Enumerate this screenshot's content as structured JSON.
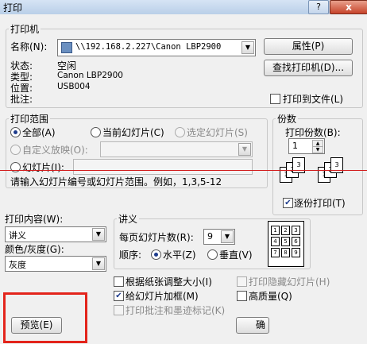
{
  "window": {
    "title": "打印",
    "help": "?",
    "close": "x"
  },
  "printer": {
    "group_label": "打印机",
    "name_label": "名称(N):",
    "name_value": "\\\\192.168.2.227\\Canon LBP2900",
    "status_label": "状态:",
    "status_value": "空闲",
    "type_label": "类型:",
    "type_value": "Canon LBP2900",
    "location_label": "位置:",
    "location_value": "USB004",
    "comment_label": "批注:",
    "properties_button": "属性(P)",
    "find_printer_button": "查找打印机(D)...",
    "print_to_file": "打印到文件(L)"
  },
  "range": {
    "group_label": "打印范围",
    "all": "全部(A)",
    "current": "当前幻灯片(C)",
    "selection": "选定幻灯片(S)",
    "custom_show": "自定义放映(O):",
    "slides": "幻灯片(I):",
    "hint": "请输入幻灯片编号或幻灯片范围。例如，1,3,5-12"
  },
  "copies": {
    "group_label": "份数",
    "count_label": "打印份数(B):",
    "count_value": "1",
    "collate": "逐份打印(T)",
    "collate_page_labels": [
      "1",
      "2",
      "3",
      "1",
      "2",
      "3"
    ]
  },
  "print_what": {
    "label": "打印内容(W):",
    "value": "讲义"
  },
  "color": {
    "label": "颜色/灰度(G):",
    "value": "灰度"
  },
  "handouts": {
    "group_label": "讲义",
    "per_page_label": "每页幻灯片数(R):",
    "per_page_value": "9",
    "order_label": "顺序:",
    "horizontal": "水平(Z)",
    "vertical": "垂直(V)",
    "layout_preview": [
      "1",
      "2",
      "3",
      "4",
      "5",
      "6",
      "7",
      "8",
      "9"
    ]
  },
  "options": {
    "scale_to_fit": "根据纸张调整大小(I)",
    "frame_slides": "给幻灯片加框(M)",
    "print_comments": "打印批注和墨迹标记(K)",
    "print_hidden": "打印隐藏幻灯片(H)",
    "high_quality": "高质量(Q)"
  },
  "buttons": {
    "preview": "预览(E)",
    "ok": "确"
  }
}
